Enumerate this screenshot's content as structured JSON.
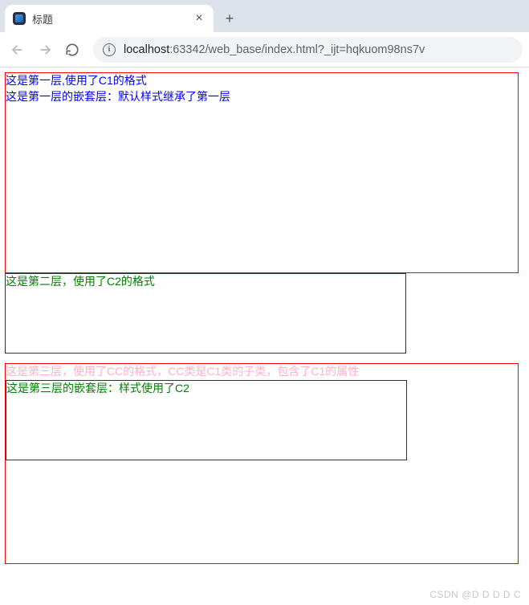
{
  "browser": {
    "tab_title": "标题",
    "new_tab_glyph": "+",
    "close_glyph": "×",
    "url_host": "localhost",
    "url_port": ":63342",
    "url_path": "/web_base/index.html?_ijt=hqkuom98ns7v",
    "info_glyph": "i"
  },
  "content": {
    "layer1": {
      "text": "这是第一层,使用了C1的格式",
      "nested": "这是第一层的嵌套层：默认样式继承了第一层"
    },
    "layer2": {
      "text": "这是第二层，使用了C2的格式"
    },
    "layer3": {
      "text": "这是第三层，使用了CC的格式，CC类是C1类的子类，包含了C1的属性",
      "nested": "这是第三层的嵌套层：样式使用了C2"
    }
  },
  "watermark": "CSDN @D D D D C"
}
